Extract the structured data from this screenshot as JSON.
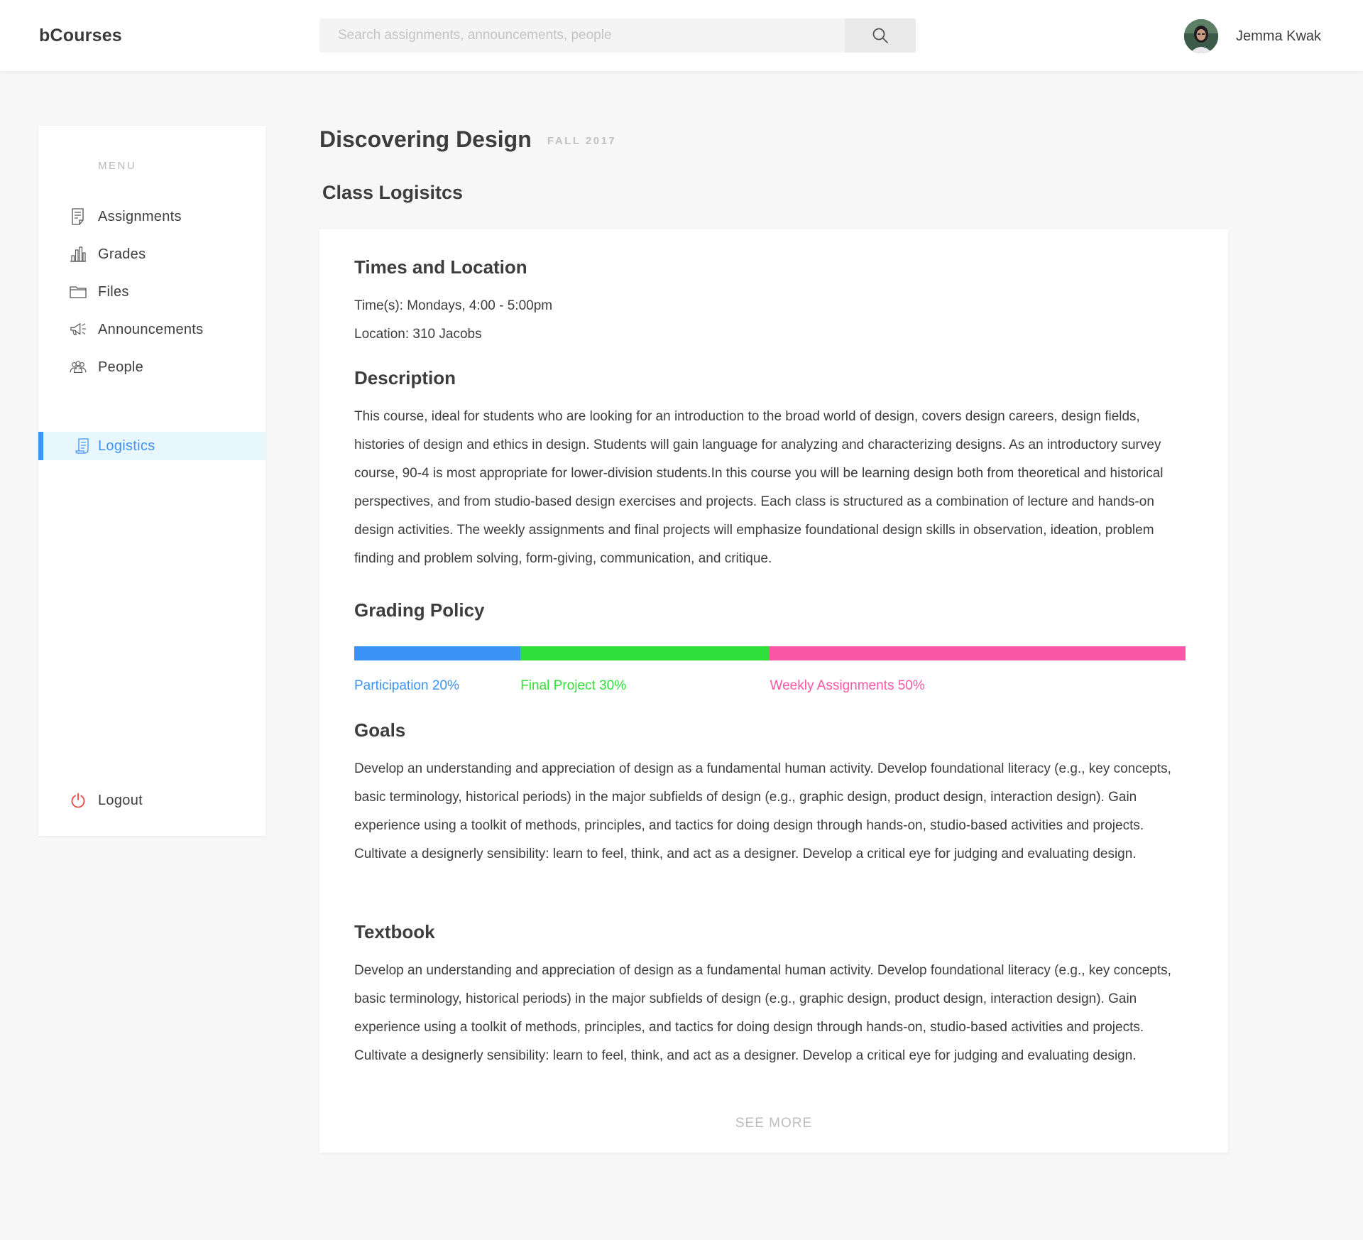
{
  "app": {
    "brand": "bCourses"
  },
  "search": {
    "placeholder": "Search assignments, announcements, people",
    "icon": "search-icon"
  },
  "user": {
    "name": "Jemma Kwak"
  },
  "sidebar": {
    "menu_label": "MENU",
    "items": [
      {
        "label": "Assignments",
        "icon": "document-icon",
        "active": false
      },
      {
        "label": "Grades",
        "icon": "bar-chart-icon",
        "active": false
      },
      {
        "label": "Files",
        "icon": "folder-icon",
        "active": false
      },
      {
        "label": "Announcements",
        "icon": "megaphone-icon",
        "active": false
      },
      {
        "label": "People",
        "icon": "people-icon",
        "active": false
      },
      {
        "label": "Logistics",
        "icon": "scroll-icon",
        "active": true
      }
    ],
    "logout_label": "Logout",
    "logout_icon": "power-icon"
  },
  "course": {
    "title": "Discovering Design",
    "term": "FALL 2017",
    "section_title": "Class Logisitcs"
  },
  "logistics": {
    "times_heading": "Times and Location",
    "times": "Time(s): Mondays, 4:00 - 5:00pm",
    "location": "Location: 310 Jacobs",
    "description_heading": "Description",
    "description": "This course, ideal for students who are looking for an introduction to the broad world of design, covers design careers, design fields, histories of design and ethics in design. Students will gain language for analyzing and characterizing designs. As an introductory survey course, 90-4 is most appropriate for lower-division students.In this course you will be learning design both from theoretical and historical perspectives, and from studio-based design exercises and projects. Each class is structured as a combination of lecture and hands-on design activities. The weekly assignments and final projects will emphasize foundational design skills in observation, ideation, problem finding and problem solving, form-giving, communication, and critique.",
    "grading_heading": "Grading Policy",
    "grading": [
      {
        "label": "Participation 20%",
        "percent": 20,
        "color": "#3b94f5"
      },
      {
        "label": "Final Project 30%",
        "percent": 30,
        "color": "#30e03a"
      },
      {
        "label": "Weekly Assignments 50%",
        "percent": 50,
        "color": "#fa57a8"
      }
    ],
    "goals_heading": "Goals",
    "goals": "Develop an understanding and appreciation of design as a fundamental human activity. Develop foundational literacy (e.g., key concepts, basic terminology, historical periods) in the major subfields of design (e.g., graphic design, product design, interaction design). Gain experience using a toolkit of methods, principles, and tactics for doing design through hands-on, studio-based activities and projects. Cultivate a designerly sensibility: learn to feel, think, and act as a designer. Develop a critical eye for judging and evaluating design.",
    "textbook_heading": "Textbook",
    "textbook": "Develop an understanding and appreciation of design as a fundamental human activity. Develop foundational literacy (e.g., key concepts, basic terminology, historical periods) in the major subfields of design (e.g., graphic design, product design, interaction design). Gain experience using a toolkit of methods, principles, and tactics for doing design through hands-on, studio-based activities and projects. Cultivate a designerly sensibility: learn to feel, think, and act as a designer. Develop a critical eye for judging and evaluating design.",
    "see_more": "SEE MORE"
  },
  "colors": {
    "accent": "#3b94f5",
    "logout": "#e8483f",
    "background": "#f7f7f7"
  }
}
